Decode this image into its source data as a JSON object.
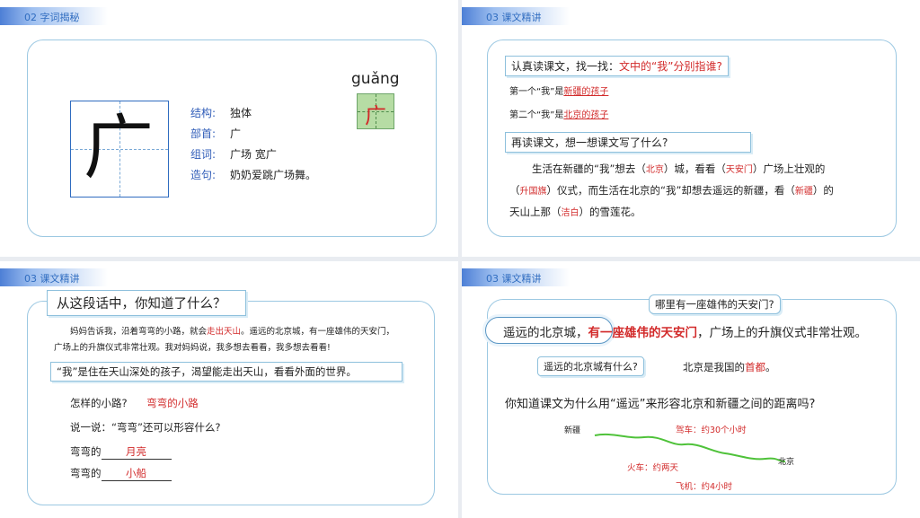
{
  "s1": {
    "section": "02  字词揭秘",
    "pinyin": "guǎng",
    "big_char": "广",
    "small_char": "广",
    "rows": [
      {
        "label": "结构:",
        "value": "独体"
      },
      {
        "label": "部首:",
        "value": "广"
      },
      {
        "label": "组词:",
        "value": "广场  宽广"
      },
      {
        "label": "造句:",
        "value": "奶奶爱跳广场舞。"
      }
    ]
  },
  "s2": {
    "section": "03  课文精讲",
    "q1_prefix": "认真读课文，找一找：",
    "q1_red": "文中的“我”分别指谁?",
    "a1_prefix": "第一个“我”是",
    "a1_red": "新疆的孩子",
    "a2_prefix": "第二个“我”是",
    "a2_red": "北京的孩子",
    "q2": "再读课文，想一想课文写了什么?",
    "p1a": "生活在新疆的“我”想去（",
    "p1b": "北京",
    "p1c": "）城，看看（",
    "p1d": "天安门",
    "p1e": "）广场上壮观的",
    "p2a": "（",
    "p2b": "升国旗",
    "p2c": "）仪式，而生活在北京的“我”却想去遥远的新疆，看（",
    "p2d": "新疆",
    "p2e": "）的",
    "p3a": "天山上那（",
    "p3b": "洁白",
    "p3c": "）的雪莲花。"
  },
  "s3": {
    "section": "03  课文精讲",
    "title": "从这段话中，你知道了什么？",
    "para1a": "妈妈告诉我，沿着弯弯的小路，就会",
    "para1red": "走出天山",
    "para1b": "。遥远的北京城，有一座雄伟的天安门，",
    "para2": "广场上的升旗仪式非常壮观。我对妈妈说，我多想去看看，我多想去看看!",
    "answer": "“我”是住在天山深处的孩子，渴望能走出天山，看看外面的世界。",
    "q1": "怎样的小路?",
    "q1_ans": "弯弯的小路",
    "q2": "说一说：“弯弯”还可以形容什么?",
    "f1": "弯弯的",
    "f1_ans": "月亮",
    "f2": "弯弯的",
    "f2_ans": "小船"
  },
  "s4": {
    "section": "03  课文精讲",
    "bubble": "哪里有一座雄伟的天安门?",
    "cloud": "遥远的北京城，",
    "main_red": "有一座雄伟的天安门",
    "main_rest": "，广场上的升旗仪式非常壮观。",
    "q_box": "遥远的北京城有什么?",
    "fact_a": "北京是我国的",
    "fact_red": "首都",
    "fact_b": "。",
    "question": "你知道课文为什么用“遥远”来形容北京和新疆之间的距离吗?",
    "map_start": "新疆",
    "map_end": "北京",
    "car": "驾车：约30个小时",
    "train": "火车：约两天",
    "plane": "飞机：约4小时",
    "line_color": "#4fc23a"
  }
}
